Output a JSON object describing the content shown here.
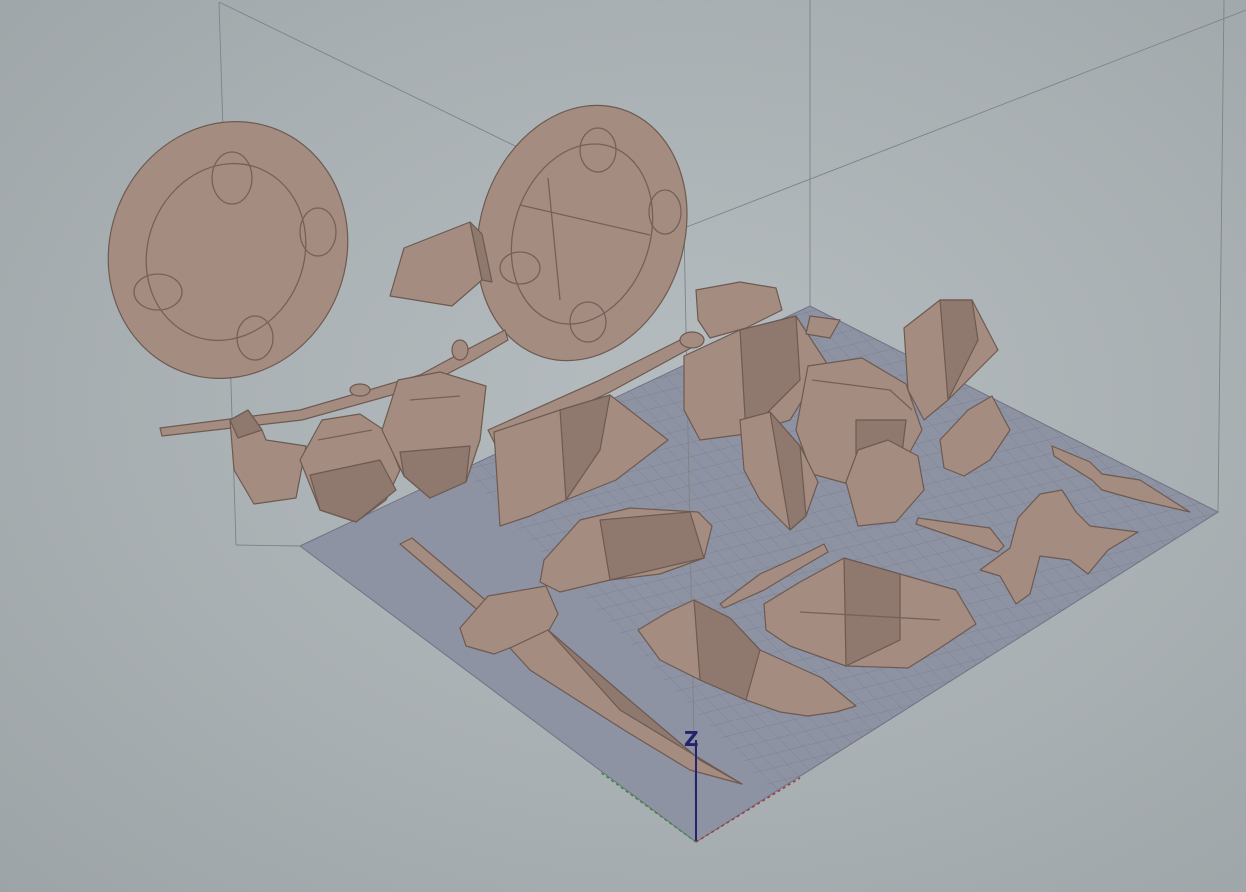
{
  "viewport": {
    "view": "perspective",
    "axis_label": "Z",
    "colors": {
      "background": "#a9b0b3",
      "bed": "#8e93a3",
      "grid": "#7a7f8f",
      "model": "#a58c80",
      "z_axis": "#23236e",
      "x_axis": "#a03a3a",
      "y_axis": "#3a8a3a"
    }
  }
}
